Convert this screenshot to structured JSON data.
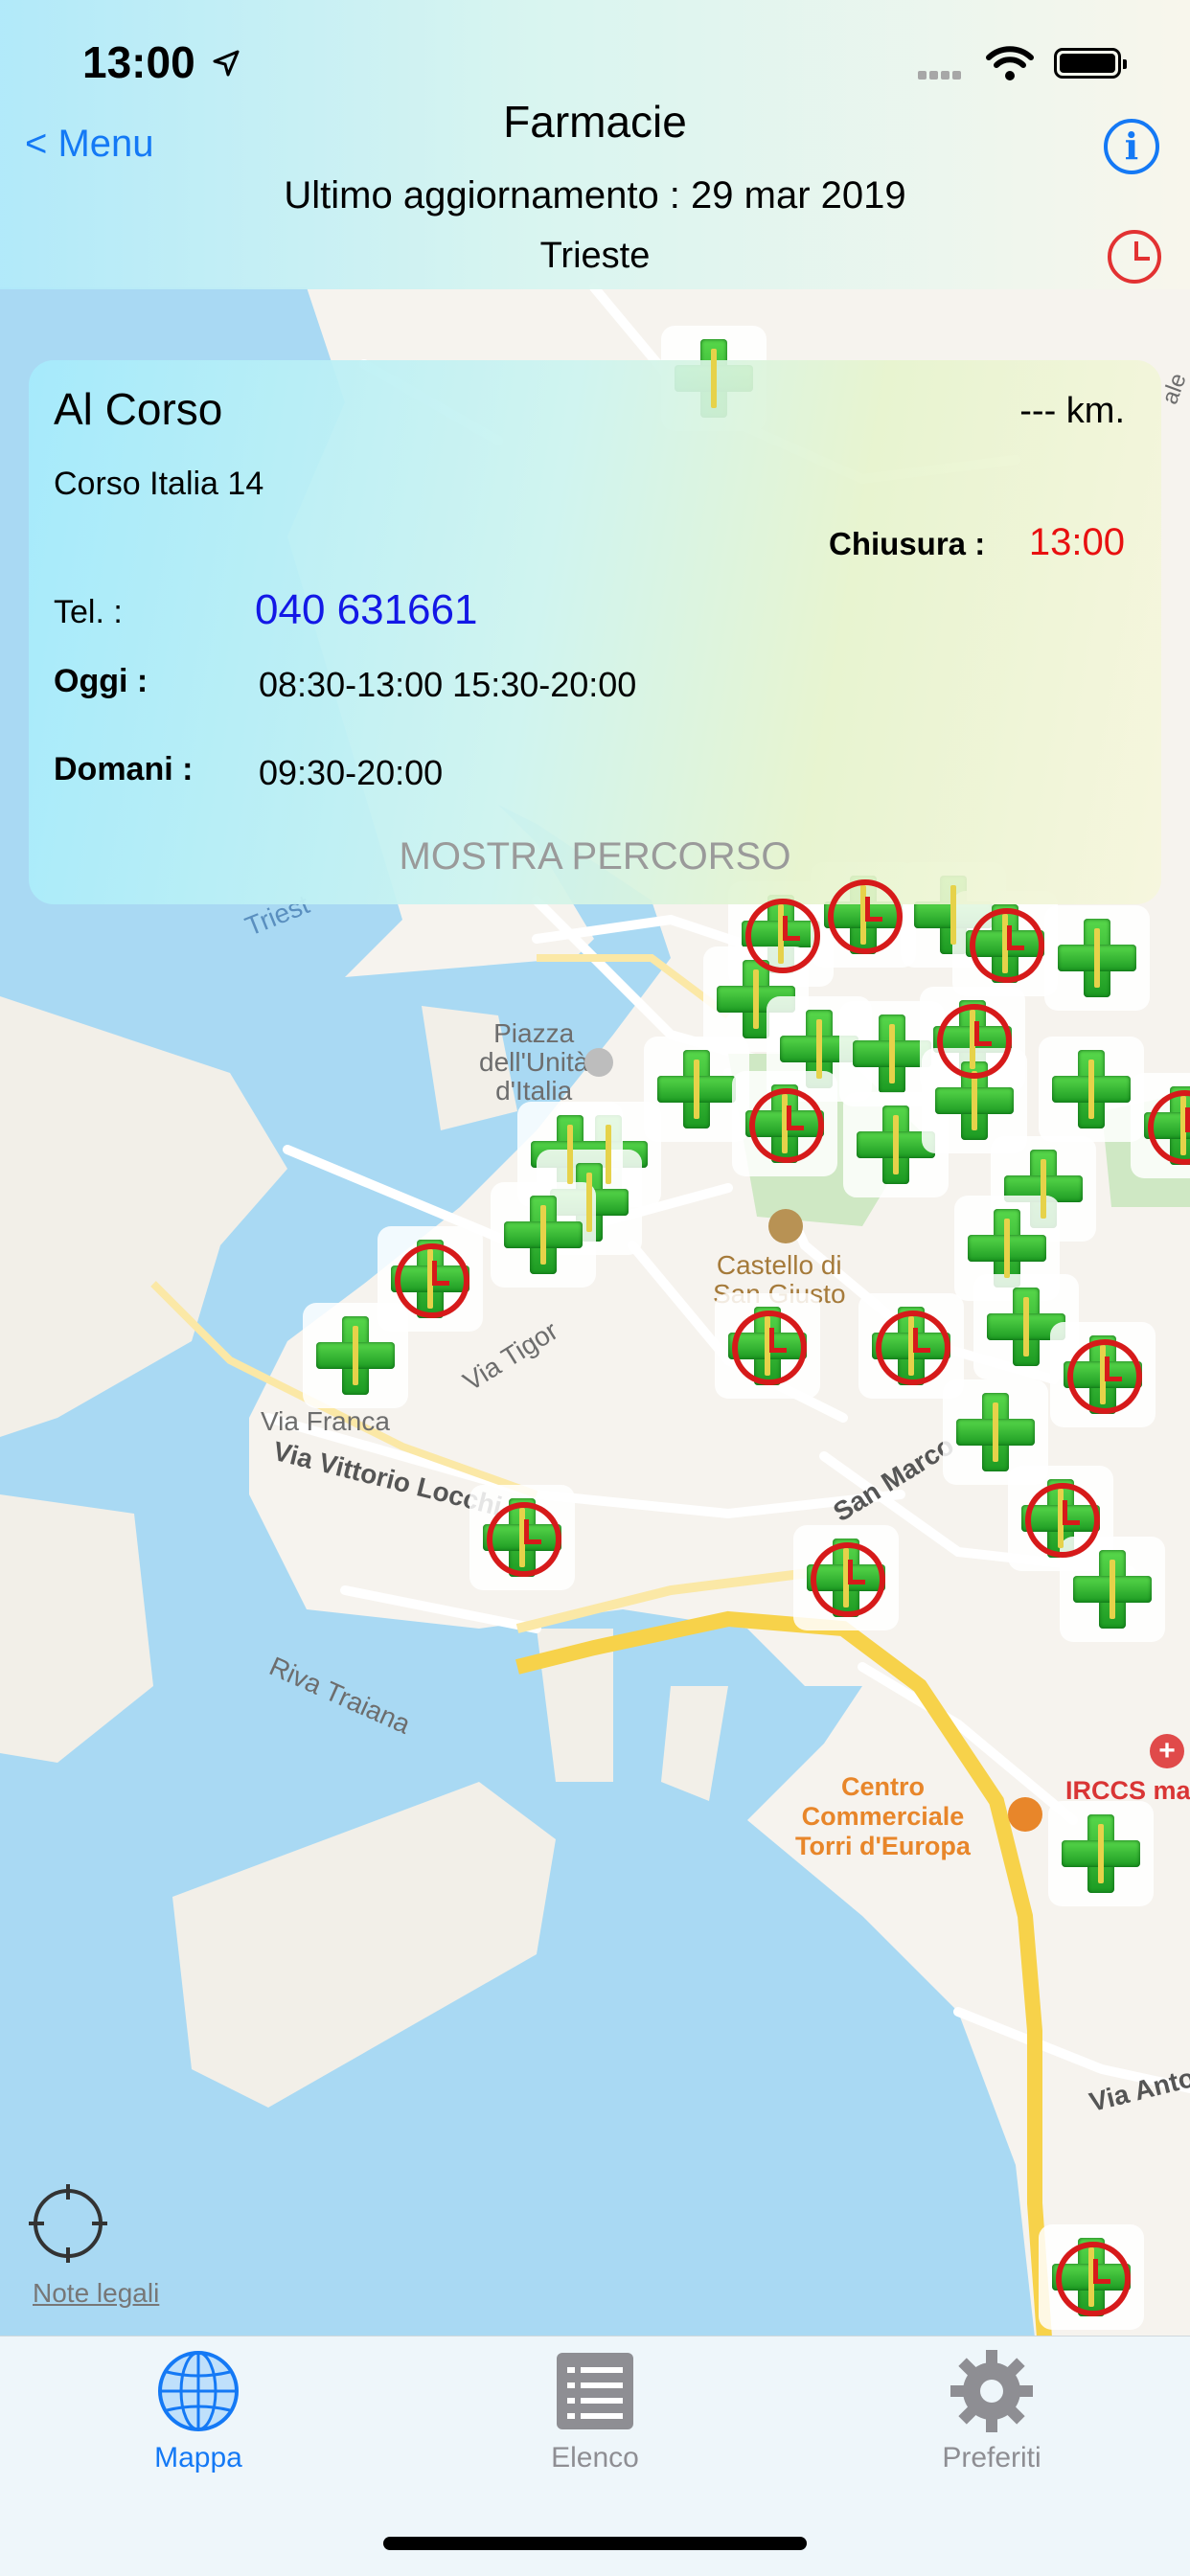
{
  "status_bar": {
    "time": "13:00"
  },
  "header": {
    "menu_label": "< Menu",
    "title": "Farmacie",
    "last_update": "Ultimo aggiornamento : 29 mar 2019",
    "city": "Trieste"
  },
  "card": {
    "name": "Al Corso",
    "distance": "--- km.",
    "address": "Corso Italia 14",
    "closing_label": "Chiusura :",
    "closing_time": "13:00",
    "tel_label": "Tel. :",
    "tel_value": "040 631661",
    "today_label": "Oggi :",
    "today_hours": "08:30-13:00 15:30-20:00",
    "tomorrow_label": "Domani :",
    "tomorrow_hours": "09:30-20:00",
    "route_button": "MOSTRA PERCORSO"
  },
  "map": {
    "labels": {
      "piazza": "Piazza\ndell'Unità\nd'Italia",
      "castello": "Castello di\nSan Giusto",
      "via_tigor": "Via Tigor",
      "via_franca": "Via Franca",
      "via_vittorio": "Via Vittorio Locchi",
      "san_marco": "San Marco",
      "riva_traiana": "Riva Traiana",
      "centro": "Centro\nCommerciale\nTorri d'Europa",
      "ircss": "IRCCS ma",
      "via_anto": "Via Anto",
      "trieste_road": "Triest",
      "ale": "ale"
    },
    "legal_notes": "Note legali"
  },
  "tabs": [
    {
      "label": "Mappa",
      "icon": "globe-icon",
      "active": true
    },
    {
      "label": "Elenco",
      "icon": "list-icon",
      "active": false
    },
    {
      "label": "Preferiti",
      "icon": "gear-icon",
      "active": false
    }
  ],
  "colors": {
    "accent": "#1479f5",
    "closing_red": "#e81010",
    "phone_blue": "#1318e6",
    "water": "#a8d8f2",
    "pharmacy_green": "#2cb52a"
  }
}
